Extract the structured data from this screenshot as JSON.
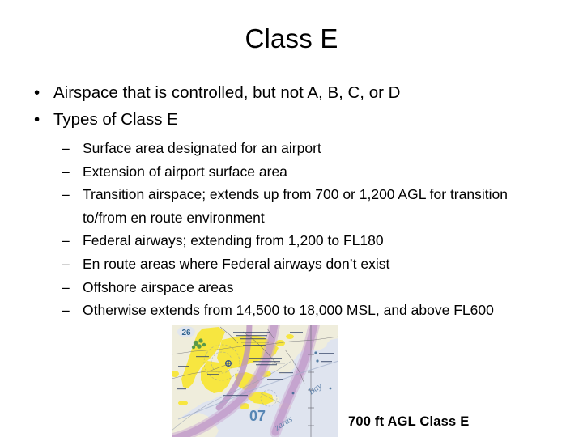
{
  "slide": {
    "title": "Class E",
    "bullets": [
      {
        "marker": "•",
        "text": "Airspace that is controlled, but not A, B, C, or D"
      },
      {
        "marker": "•",
        "text": "Types of Class E"
      }
    ],
    "sub_bullets": [
      {
        "marker": "–",
        "text": "Surface area designated for an airport"
      },
      {
        "marker": "–",
        "text": "Extension of airport surface area"
      },
      {
        "marker": "–",
        "text": "Transition airspace; extends up from 700 or 1,200 AGL for transition to/from en route environment"
      },
      {
        "marker": "–",
        "text": "Federal airways; extending from 1,200 to FL180"
      },
      {
        "marker": "–",
        "text": "En route areas where Federal airways don’t exist"
      },
      {
        "marker": "–",
        "text": "Offshore airspace areas"
      },
      {
        "marker": "–",
        "text": "Otherwise extends from 14,500 to 18,000 MSL, and above FL600"
      }
    ],
    "figure": {
      "name": "sectional-chart-excerpt",
      "caption": "700 ft AGL Class E",
      "map_labels": {
        "grid_number": "26",
        "quadrant_number": "07",
        "water_body_line1": "zards",
        "water_body_line2": "Bay"
      },
      "colors": {
        "water": "#dfe4ef",
        "land": "#efeddc",
        "urban_yellow": "#f7e640",
        "class_e_magenta": "#b98fc2",
        "label_blue": "#5a7fa8",
        "grid_line": "#6d6d78"
      }
    }
  }
}
